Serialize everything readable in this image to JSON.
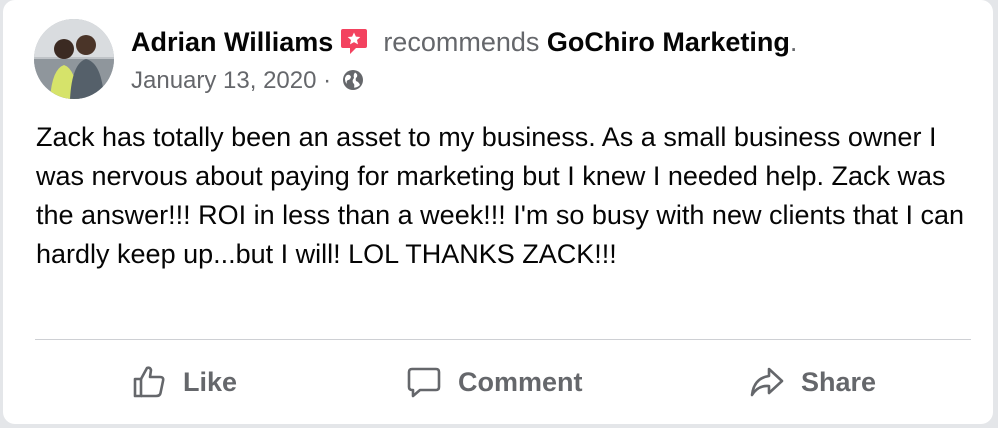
{
  "post": {
    "author": "Adrian Williams",
    "verb": "recommends",
    "page_name": "GoChiro Marketing",
    "period": ".",
    "date": "January 13, 2020",
    "separator": "·",
    "body": "Zack has totally been an asset to my business. As a small business owner I was nervous about paying for marketing but I knew I needed help. Zack was the answer!!! ROI in less than a week!!! I'm so busy with new clients that I can hardly keep up...but I will! LOL THANKS ZACK!!!"
  },
  "actions": {
    "like_label": "Like",
    "comment_label": "Comment",
    "share_label": "Share"
  },
  "icons": {
    "recommend_badge": "recommendation-star-icon",
    "audience": "globe-icon",
    "like": "thumbs-up-icon",
    "comment": "speech-bubble-icon",
    "share": "share-arrow-icon"
  },
  "colors": {
    "primary_text": "#050505",
    "secondary_text": "#65676b",
    "badge": "#f3425f",
    "divider": "#ced0d4"
  }
}
